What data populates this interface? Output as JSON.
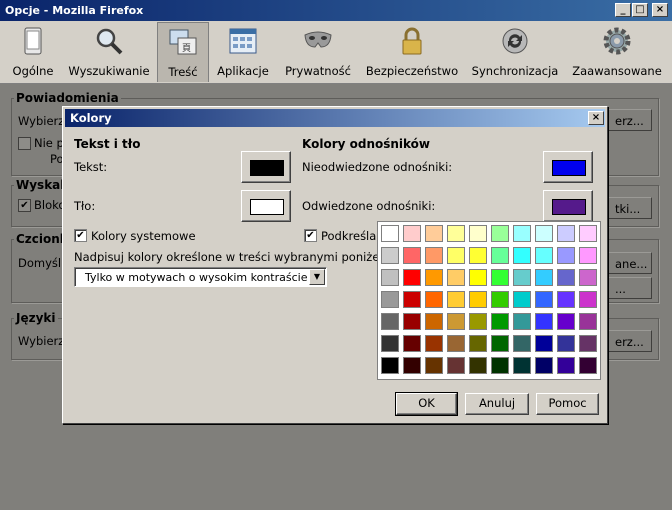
{
  "window": {
    "title": "Opcje - Mozilla Firefox",
    "controls": {
      "minimize": "_",
      "maximize": "□",
      "close": "×"
    }
  },
  "toolbar": {
    "items": [
      {
        "label": "Ogólne",
        "icon": "general-icon"
      },
      {
        "label": "Wyszukiwanie",
        "icon": "search-icon"
      },
      {
        "label": "Treść",
        "icon": "content-icon",
        "selected": true
      },
      {
        "label": "Aplikacje",
        "icon": "applications-icon"
      },
      {
        "label": "Prywatność",
        "icon": "privacy-mask-icon"
      },
      {
        "label": "Bezpieczeństwo",
        "icon": "lock-icon"
      },
      {
        "label": "Synchronizacja",
        "icon": "sync-icon"
      },
      {
        "label": "Zaawansowane",
        "icon": "gear-icon"
      }
    ]
  },
  "background": {
    "notifications": {
      "legend": "Powiadomienia",
      "text1": "Wybierz",
      "text2": "Nie p",
      "text3": "Po",
      "button": "erz..."
    },
    "popups": {
      "legend": "Wyskak",
      "checkbox": "Bloko",
      "button": "tki..."
    },
    "fonts": {
      "legend": "Czcionk",
      "text": "Domyśln",
      "button1": "ane...",
      "button2": "..."
    },
    "languages": {
      "legend": "Języki",
      "text": "Wybierz",
      "button": "erz..."
    }
  },
  "dialog": {
    "title": "Kolory",
    "close": "×",
    "text_section": {
      "heading": "Tekst i tło",
      "text_label": "Tekst:",
      "text_color": "#000000",
      "bg_label": "Tło:",
      "bg_color": "#ffffff",
      "system_colors_label": "Kolory systemowe",
      "system_colors_checked": true
    },
    "links_section": {
      "heading": "Kolory odnośników",
      "unvisited_label": "Nieodwiedzone odnośniki:",
      "unvisited_color": "#0000ee",
      "visited_label": "Odwiedzone odnośniki:",
      "visited_color": "#551a8b",
      "underline_label": "Podkreślanie",
      "underline_checked": true
    },
    "override": {
      "label": "Nadpisuj kolory określone w treści wybranymi poniżej:",
      "selected": "Tylko w motywach o wysokim kontraście"
    },
    "buttons": {
      "ok": "OK",
      "cancel": "Anuluj",
      "help": "Pomoc"
    },
    "palette": [
      [
        "#ffffff",
        "#ffcccc",
        "#ffcc99",
        "#ffff99",
        "#ffffcc",
        "#99ff99",
        "#99ffff",
        "#ccffff",
        "#ccccff",
        "#ffccff"
      ],
      [
        "#cccccc",
        "#ff6666",
        "#ff9966",
        "#ffff66",
        "#ffff33",
        "#66ff99",
        "#33ffff",
        "#66ffff",
        "#9999ff",
        "#ff99ff"
      ],
      [
        "#c0c0c0",
        "#ff0000",
        "#ff9900",
        "#ffcc66",
        "#ffff00",
        "#33ff33",
        "#66cccc",
        "#33ccff",
        "#6666cc",
        "#cc66cc"
      ],
      [
        "#999999",
        "#cc0000",
        "#ff6600",
        "#ffcc33",
        "#ffcc00",
        "#33cc00",
        "#00cccc",
        "#3366ff",
        "#6633ff",
        "#cc33cc"
      ],
      [
        "#666666",
        "#990000",
        "#cc6600",
        "#cc9933",
        "#999900",
        "#009900",
        "#339999",
        "#3333ff",
        "#6600cc",
        "#993399"
      ],
      [
        "#333333",
        "#660000",
        "#993300",
        "#996633",
        "#666600",
        "#006600",
        "#336666",
        "#000099",
        "#333399",
        "#663366"
      ],
      [
        "#000000",
        "#330000",
        "#663300",
        "#663333",
        "#333300",
        "#003300",
        "#003333",
        "#000066",
        "#330099",
        "#330033"
      ]
    ]
  }
}
